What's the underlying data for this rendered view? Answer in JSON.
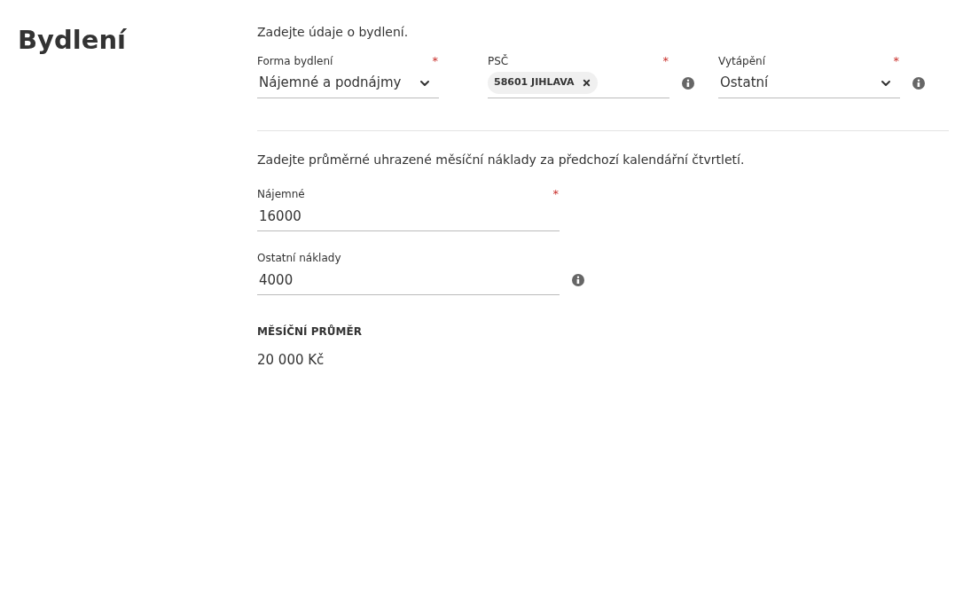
{
  "title": "Bydlení",
  "section_1": {
    "intro": "Zadejte údaje o bydlení.",
    "fields": [
      {
        "kind": "select",
        "label": "Forma bydlení",
        "required_mark": "*",
        "value": "Nájemné a podnájmy",
        "info": false
      },
      {
        "kind": "tag",
        "label": "PSČ",
        "required_mark": "*",
        "value": "58601 JIHLAVA",
        "info": true
      },
      {
        "kind": "select",
        "label": "Vytápění",
        "required_mark": "*",
        "value": "Ostatní",
        "info": true
      }
    ]
  },
  "section_2": {
    "intro": "Zadejte průměrné uhrazené měsíční náklady za předchozí kalendářní čtvrtletí.",
    "fields": [
      {
        "kind": "text",
        "label": "Nájemné",
        "required_mark": "*",
        "value": "16000",
        "info": false
      },
      {
        "kind": "text",
        "label": "Ostatní náklady",
        "value": "4000",
        "info": true
      }
    ]
  },
  "summary": {
    "label": "MĚSÍČNÍ PRŮMĚR",
    "value": "20 000 Kč"
  }
}
